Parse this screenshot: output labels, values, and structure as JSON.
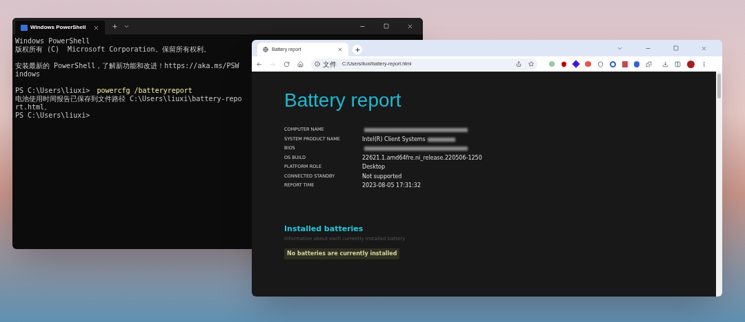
{
  "terminal": {
    "tab_title": "Windows PowerShell",
    "lines": [
      {
        "kind": "text",
        "text": "Windows PowerShell"
      },
      {
        "kind": "text",
        "text": "版权所有 (C)  Microsoft Corporation。保留所有权利。"
      },
      {
        "kind": "blank"
      },
      {
        "kind": "text",
        "text": "安装最新的 PowerShell，了解新功能和改进！https://aka.ms/PSWindows"
      },
      {
        "kind": "blank"
      },
      {
        "kind": "command",
        "prompt": "PS C:\\Users\\liuxi>",
        "command": "powercfg /batteryreport"
      },
      {
        "kind": "text",
        "text": "电池使用时间报告已保存到文件路径 C:\\Users\\liuxi\\battery-report.html。"
      },
      {
        "kind": "command",
        "prompt": "PS C:\\Users\\liuxi>"
      }
    ]
  },
  "browser": {
    "tab_title": "Battery report",
    "address_label": "文件",
    "url": "C:/Users/liuxi/battery-report.html",
    "page": {
      "title": "Battery report",
      "info": [
        {
          "label": "COMPUTER NAME",
          "redacted": true
        },
        {
          "label": "SYSTEM PRODUCT NAME",
          "value": "Intel(R) Client Systems",
          "redacted": true
        },
        {
          "label": "BIOS",
          "redacted": true
        },
        {
          "label": "OS BUILD",
          "value": "22621.1.amd64fre.ni_release.220506-1250"
        },
        {
          "label": "PLATFORM ROLE",
          "value": "Desktop"
        },
        {
          "label": "CONNECTED STANDBY",
          "value": "Not supported"
        },
        {
          "label": "REPORT TIME",
          "value": "2023-08-05  17:31:32"
        }
      ],
      "section_title": "Installed batteries",
      "section_subtitle": "Information about each currently installed battery",
      "notice": "No batteries are currently installed"
    }
  }
}
